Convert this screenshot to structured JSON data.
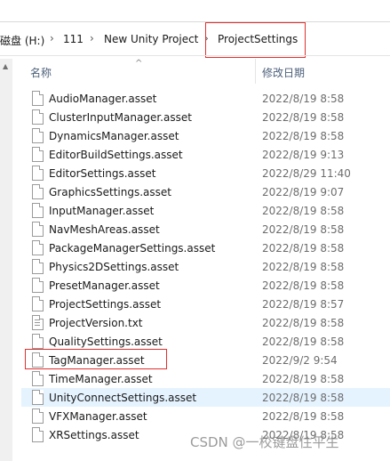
{
  "breadcrumb": {
    "items": [
      "磁盘 (H:)",
      "111",
      "New Unity Project",
      "ProjectSettings"
    ],
    "separator": "›"
  },
  "header": {
    "name_label": "名称",
    "date_label": "修改日期"
  },
  "files": [
    {
      "name": "AudioManager.asset",
      "date": "2022/8/19 8:58",
      "icon": "file-icon"
    },
    {
      "name": "ClusterInputManager.asset",
      "date": "2022/8/19 8:58",
      "icon": "file-icon"
    },
    {
      "name": "DynamicsManager.asset",
      "date": "2022/8/19 8:58",
      "icon": "file-icon"
    },
    {
      "name": "EditorBuildSettings.asset",
      "date": "2022/8/19 9:13",
      "icon": "file-icon"
    },
    {
      "name": "EditorSettings.asset",
      "date": "2022/8/29 11:40",
      "icon": "file-icon"
    },
    {
      "name": "GraphicsSettings.asset",
      "date": "2022/8/19 9:07",
      "icon": "file-icon"
    },
    {
      "name": "InputManager.asset",
      "date": "2022/8/19 8:58",
      "icon": "file-icon"
    },
    {
      "name": "NavMeshAreas.asset",
      "date": "2022/8/19 8:58",
      "icon": "file-icon"
    },
    {
      "name": "PackageManagerSettings.asset",
      "date": "2022/8/19 8:58",
      "icon": "file-icon"
    },
    {
      "name": "Physics2DSettings.asset",
      "date": "2022/8/19 8:58",
      "icon": "file-icon"
    },
    {
      "name": "PresetManager.asset",
      "date": "2022/8/19 8:58",
      "icon": "file-icon"
    },
    {
      "name": "ProjectSettings.asset",
      "date": "2022/8/19 8:57",
      "icon": "file-icon"
    },
    {
      "name": "ProjectVersion.txt",
      "date": "2022/8/19 8:58",
      "icon": "text-file-icon"
    },
    {
      "name": "QualitySettings.asset",
      "date": "2022/8/19 8:58",
      "icon": "file-icon"
    },
    {
      "name": "TagManager.asset",
      "date": "2022/9/2 9:54",
      "icon": "file-icon"
    },
    {
      "name": "TimeManager.asset",
      "date": "2022/8/19 8:58",
      "icon": "file-icon"
    },
    {
      "name": "UnityConnectSettings.asset",
      "date": "2022/8/19 8:58",
      "icon": "file-icon"
    },
    {
      "name": "VFXManager.asset",
      "date": "2022/8/19 8:58",
      "icon": "file-icon"
    },
    {
      "name": "XRSettings.asset",
      "date": "2022/8/19 8:58",
      "icon": "file-icon"
    }
  ],
  "selected_file": "UnityConnectSettings.asset",
  "highlighted": [
    "ProjectSettings",
    "TagManager.asset"
  ],
  "colors": {
    "highlight_border": "#e03030",
    "selected_row": "#e5f3ff",
    "header_text": "#4c607a"
  },
  "watermark": "CSDN @一校键盘住平生"
}
